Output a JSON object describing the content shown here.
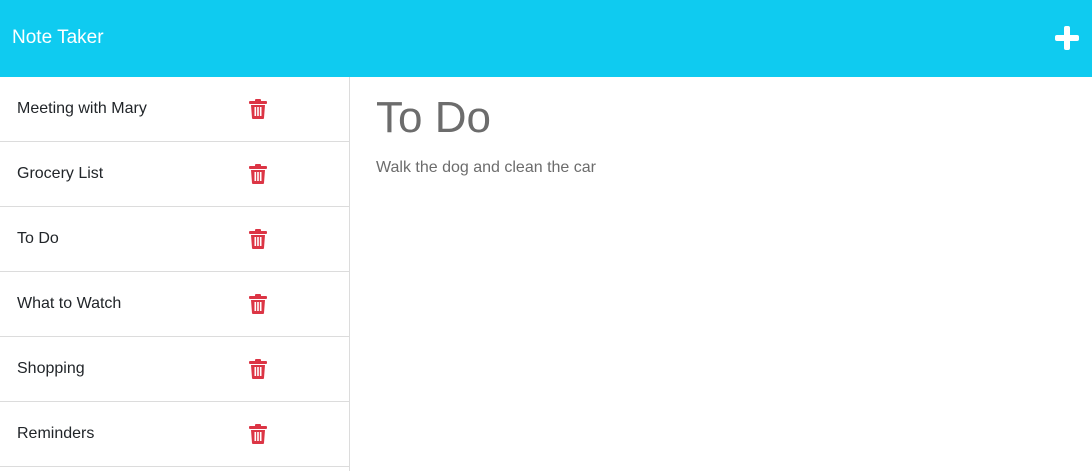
{
  "app": {
    "title": "Note Taker",
    "new_note_icon": "plus-icon",
    "colors": {
      "navbar": "#0fcbf0",
      "delete": "#dc3545",
      "note_text": "#6c6c6c"
    }
  },
  "notes": [
    {
      "title": "Meeting with Mary",
      "icon": "trash-icon"
    },
    {
      "title": "Grocery List",
      "icon": "trash-icon"
    },
    {
      "title": "To Do",
      "icon": "trash-icon"
    },
    {
      "title": "What to Watch",
      "icon": "trash-icon"
    },
    {
      "title": "Shopping",
      "icon": "trash-icon"
    },
    {
      "title": "Reminders",
      "icon": "trash-icon"
    }
  ],
  "active_note": {
    "title": "To Do",
    "text": "Walk the dog and clean the car"
  }
}
